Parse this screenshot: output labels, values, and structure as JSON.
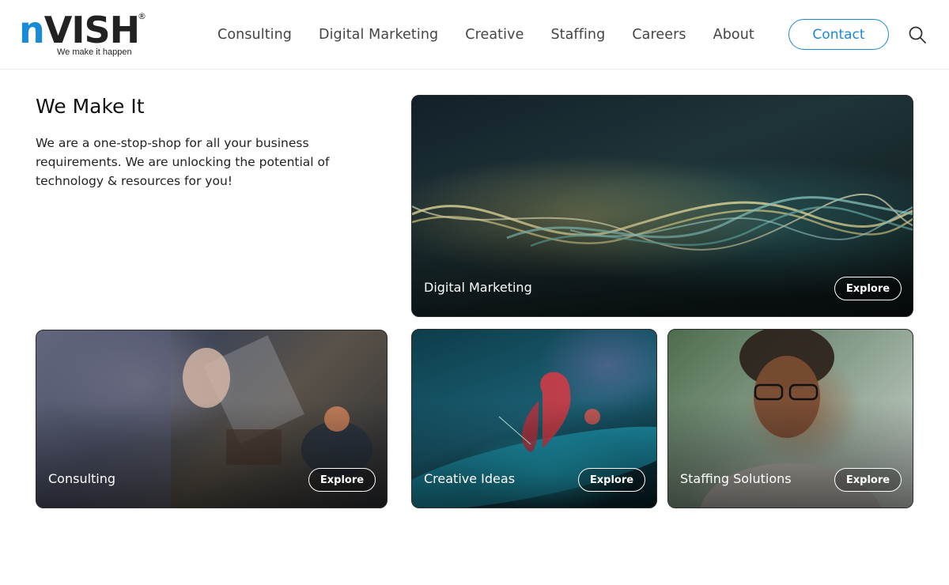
{
  "header": {
    "logo": {
      "mark": "nVISH",
      "mark_first": "n",
      "mark_rest": "VISH",
      "registered": "®",
      "tagline": "We make it happen"
    },
    "nav": [
      "Consulting",
      "Digital Marketing",
      "Creative",
      "Staffing",
      "Careers",
      "About"
    ],
    "contact_label": "Contact",
    "search_icon": "search-icon"
  },
  "intro": {
    "title": "We Make It",
    "text": "We are a one-stop-shop for all your business requirements. We are unlocking the potential of technology & resources for you!"
  },
  "cards": [
    {
      "label": "Digital Marketing",
      "button": "Explore"
    },
    {
      "label": "Consulting",
      "button": "Explore"
    },
    {
      "label": "Creative Ideas",
      "button": "Explore"
    },
    {
      "label": "Staffing Solutions",
      "button": "Explore"
    }
  ],
  "colors": {
    "accent": "#1a8ad6",
    "text": "#1b1b1b",
    "nav_text": "#444444"
  }
}
